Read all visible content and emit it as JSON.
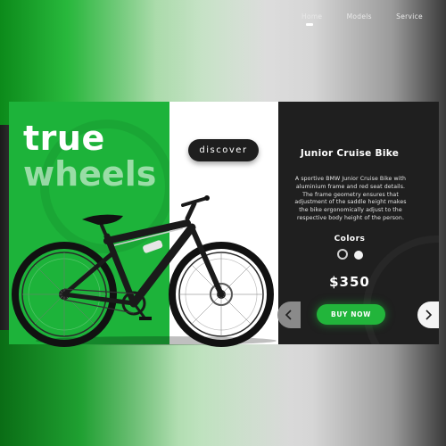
{
  "brand": {
    "line1": "true",
    "line2": "wheels"
  },
  "hero": {
    "discover_label": "discover"
  },
  "nav": {
    "items": [
      {
        "label": "Home"
      },
      {
        "label": "Models"
      },
      {
        "label": "Service"
      }
    ],
    "active": "Home"
  },
  "product": {
    "title": "Junior Cruise Bike",
    "description": "A sportive BMW Junior Cruise Bike with aluminium frame and red seat details. The frame geometry ensures that adjustment of the saddle height makes the bike ergonomically adjust to the respective body height of the person.",
    "colors_label": "Colors",
    "colors": [
      {
        "name": "black",
        "hex": "#1a1a1a",
        "selected": true
      },
      {
        "name": "white",
        "hex": "#f2f2f2",
        "selected": false
      }
    ],
    "price": "$350",
    "buy_label": "BUY NOW"
  },
  "theme": {
    "accent": "#1db33a",
    "dark": "#1f1f1f",
    "light": "#ffffff"
  },
  "icons": {
    "prev": "chevron-left-icon",
    "next": "chevron-right-icon"
  }
}
